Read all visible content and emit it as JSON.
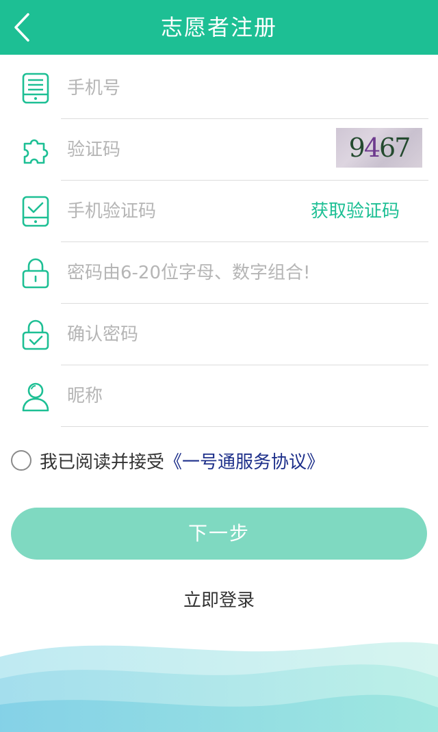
{
  "header": {
    "title": "志愿者注册"
  },
  "form": {
    "phone": {
      "placeholder": "手机号",
      "value": ""
    },
    "captcha": {
      "placeholder": "验证码",
      "value": "",
      "image_text": [
        "9",
        "4",
        "6",
        "7"
      ]
    },
    "sms_code": {
      "placeholder": "手机验证码",
      "value": "",
      "get_code_label": "获取验证码"
    },
    "password": {
      "placeholder": "密码由6-20位字母、数字组合!",
      "value": ""
    },
    "confirm_password": {
      "placeholder": "确认密码",
      "value": ""
    },
    "nickname": {
      "placeholder": "昵称",
      "value": ""
    }
  },
  "agreement": {
    "checked": false,
    "text": "我已阅读并接受",
    "link": "《一号通服务协议》"
  },
  "actions": {
    "next_label": "下一步",
    "login_label": "立即登录"
  },
  "colors": {
    "brand": "#1dbf94",
    "button": "#7fd9c1",
    "link": "#1d2f8a"
  },
  "icons": {
    "back": "chevron-left-icon",
    "phone": "phone-list-icon",
    "captcha": "puzzle-icon",
    "sms": "phone-check-icon",
    "password": "lock-icon",
    "confirm": "lock-check-icon",
    "nickname": "user-icon"
  }
}
